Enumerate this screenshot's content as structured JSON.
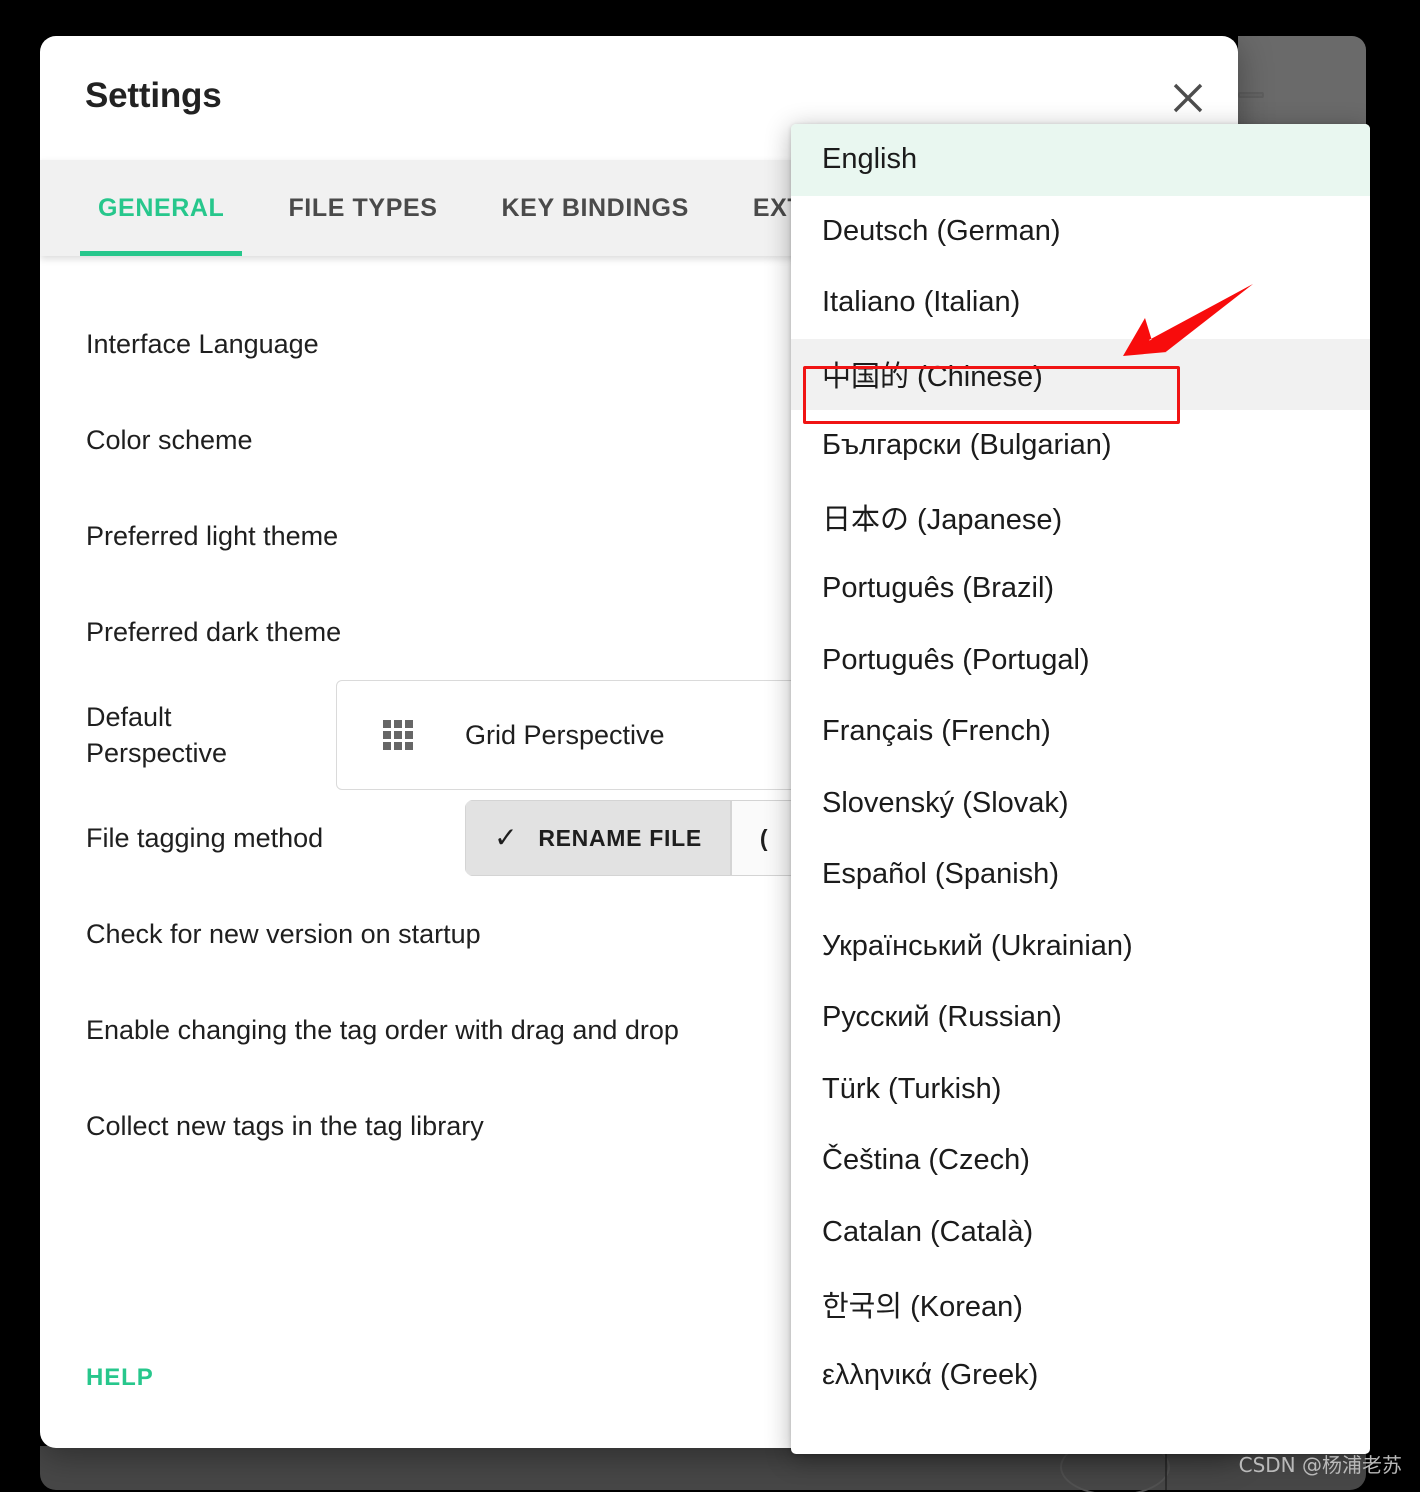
{
  "dialog": {
    "title": "Settings",
    "close_icon": "close-icon",
    "tabs": [
      {
        "label": "GENERAL",
        "active": true
      },
      {
        "label": "FILE TYPES",
        "active": false
      },
      {
        "label": "KEY BINDINGS",
        "active": false
      },
      {
        "label": "EXT",
        "active": false
      }
    ],
    "help_label": "HELP"
  },
  "settings": {
    "interface_language_label": "Interface Language",
    "color_scheme_label": "Color scheme",
    "preferred_light_theme_label": "Preferred light theme",
    "preferred_dark_theme_label": "Preferred dark theme",
    "default_perspective_label": "Default\nPerspective",
    "default_perspective_value": "Grid Perspective",
    "default_perspective_icon": "grid-icon",
    "file_tagging_method_label": "File tagging method",
    "file_tagging_selected": "RENAME FILE",
    "file_tagging_check_icon": "check-icon",
    "file_tagging_alt": "(",
    "check_new_version_label": "Check for new version on startup",
    "tag_drag_drop_label": "Enable changing the tag order with drag and drop",
    "collect_new_tags_label": "Collect new tags in the tag library"
  },
  "language_dropdown": {
    "items": [
      {
        "label": "English",
        "state": "selected"
      },
      {
        "label": "Deutsch (German)",
        "state": "normal"
      },
      {
        "label": "Italiano (Italian)",
        "state": "normal"
      },
      {
        "label": "中国的 (Chinese)",
        "state": "hovered"
      },
      {
        "label": "Български (Bulgarian)",
        "state": "normal"
      },
      {
        "label": "日本の (Japanese)",
        "state": "normal"
      },
      {
        "label": "Português (Brazil)",
        "state": "normal"
      },
      {
        "label": "Português (Portugal)",
        "state": "normal"
      },
      {
        "label": "Français (French)",
        "state": "normal"
      },
      {
        "label": "Slovenský (Slovak)",
        "state": "normal"
      },
      {
        "label": "Español (Spanish)",
        "state": "normal"
      },
      {
        "label": "Український (Ukrainian)",
        "state": "normal"
      },
      {
        "label": "Русский (Russian)",
        "state": "normal"
      },
      {
        "label": "Türk (Turkish)",
        "state": "normal"
      },
      {
        "label": "Čeština (Czech)",
        "state": "normal"
      },
      {
        "label": "Catalan (Català)",
        "state": "normal"
      },
      {
        "label": "한국의 (Korean)",
        "state": "normal"
      },
      {
        "label": "ελληνικά (Greek)",
        "state": "normal"
      }
    ]
  },
  "annotations": {
    "highlight_color": "#f01414",
    "arrow_icon": "arrow-pointing-down-left-icon",
    "box_target": "中国的 (Chinese)"
  },
  "watermark": {
    "text": "CSDN @杨浦老苏"
  },
  "colors": {
    "accent_green": "#27c78c",
    "selected_row": "#e9f7f0",
    "hovered_row": "#f1f1f1",
    "annotation_red": "#f01414"
  }
}
